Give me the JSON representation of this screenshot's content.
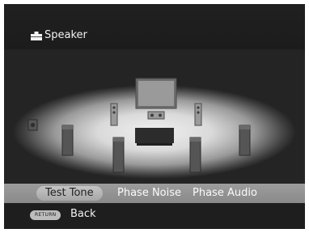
{
  "header": {
    "title": "Speaker",
    "icon": "speaker-setup-icon"
  },
  "menu": {
    "items": [
      {
        "label": "Test Tone",
        "selected": true
      },
      {
        "label": "Phase Noise",
        "selected": false
      },
      {
        "label": "Phase Audio",
        "selected": false
      }
    ]
  },
  "footer": {
    "return_key": "RETURN",
    "back_label": "Back"
  }
}
